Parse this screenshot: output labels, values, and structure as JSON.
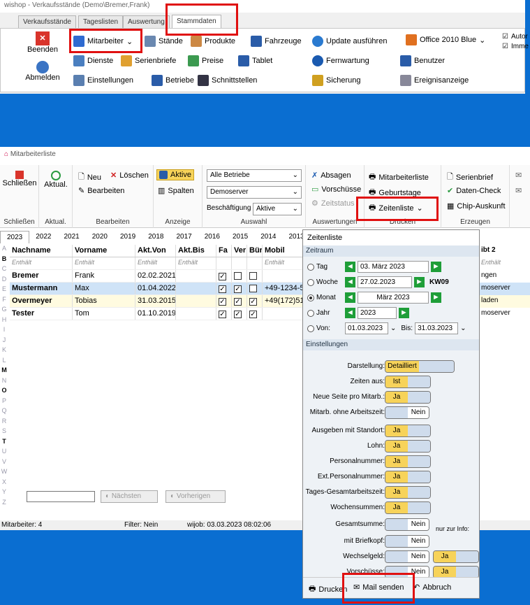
{
  "app": {
    "title": "wishop - Verkaufsstände (Demo\\Bremer,Frank)",
    "tabs": [
      "Verkaufsstände",
      "Tageslisten",
      "Auswertung",
      "Stammdaten"
    ]
  },
  "ribbon1": {
    "beenden": "Beenden",
    "abmelden": "Abmelden",
    "mitarbeiter": "Mitarbeiter",
    "staende": "Stände",
    "produkte": "Produkte",
    "fahrzeuge": "Fahrzeuge",
    "dienste": "Dienste",
    "serienbriefe": "Serienbriefe",
    "preise": "Preise",
    "tablet": "Tablet",
    "einstellungen": "Einstellungen",
    "betriebe": "Betriebe",
    "schnittstellen": "Schnittstellen",
    "update": "Update ausführen",
    "fernwartung": "Fernwartung",
    "sicherung": "Sicherung",
    "office": "Office 2010 Blue",
    "benutzer": "Benutzer",
    "ereignis": "Ereignisanzeige",
    "autor": "Autor",
    "imme": "Imme"
  },
  "win2": {
    "title": "Mitarbeiterliste"
  },
  "ribbon2": {
    "schliessen": "Schließen",
    "aktual": "Aktual.",
    "neu": "Neu",
    "loeschen": "Löschen",
    "bearbeiten": "Bearbeiten",
    "aktive": "Aktive",
    "spalten": "Spalten",
    "alle_betriebe": "Alle Betriebe",
    "demoserver": "Demoserver",
    "beschaeftigung": "Beschäftigung",
    "aktive_sel": "Aktive",
    "absagen": "Absagen",
    "vorschuesse": "Vorschüsse",
    "zeitstatus": "Zeitstatus",
    "mitarbeiterliste": "Mitarbeiterliste",
    "geburtstage": "Geburtstage",
    "zeitenliste": "Zeitenliste",
    "serienbrief": "Serienbrief",
    "datencheck": "Daten-Check",
    "chip": "Chip-Auskunft",
    "g_schliessen": "Schließen",
    "g_aktual": "Aktual.",
    "g_bearbeiten": "Bearbeiten",
    "g_anzeige": "Anzeige",
    "g_auswahl": "Auswahl",
    "g_auswertungen": "Auswertungen",
    "g_drucken": "Drucken",
    "g_erzeugen": "Erzeugen"
  },
  "years": [
    "2023",
    "2022",
    "2021",
    "2020",
    "2019",
    "2018",
    "2017",
    "2016",
    "2015",
    "2014",
    "2013"
  ],
  "letters": [
    "A",
    "B",
    "C",
    "D",
    "E",
    "F",
    "G",
    "H",
    "I",
    "J",
    "K",
    "L",
    "M",
    "N",
    "O",
    "P",
    "Q",
    "R",
    "S",
    "T",
    "U",
    "V",
    "W",
    "X",
    "Y",
    "Z"
  ],
  "table": {
    "headers": [
      "Nachname",
      "Vorname",
      "Akt.Von",
      "Akt.Bis",
      "Fa",
      "Ver",
      "Bür",
      "Mobil"
    ],
    "filter": "Enthält",
    "rows": [
      [
        "Bremer",
        "Frank",
        "02.02.2021",
        "",
        "✓",
        "",
        "",
        " "
      ],
      [
        "Mustermann",
        "Max",
        "01.04.2022",
        "",
        "✓",
        "✓",
        "",
        "+49-1234-5"
      ],
      [
        "Overmeyer",
        "Tobias",
        "31.03.2015",
        "",
        "✓",
        "✓",
        "✓",
        "+49(172)51"
      ],
      [
        "Tester",
        "Tom",
        "01.10.2019",
        "",
        "✓",
        "✓",
        "✓",
        ""
      ]
    ],
    "right_header": "ibt 2",
    "right_rows": [
      "ngen",
      "moserver",
      "laden",
      "moserver"
    ]
  },
  "search": {
    "naechsten": "Nächsten",
    "vorherigen": "Vorherigen"
  },
  "status": {
    "count": "Mitarbeiter: 4",
    "filter": "Filter: Nein",
    "job": "wijob: 03.03.2023 08:02:06"
  },
  "panel": {
    "title": "Zeitenliste",
    "zeitraum": "Zeitraum",
    "tag": "Tag",
    "woche": "Woche",
    "monat": "Monat",
    "jahr": "Jahr",
    "von": "Von:",
    "bis": "Bis:",
    "tag_val": "03.  März    2023",
    "woche_val": "27.02.2023",
    "kw": "KW09",
    "monat_val": "März    2023",
    "jahr_val": "2023",
    "von_val": "01.03.2023",
    "bis_val": "31.03.2023",
    "einstellungen": "Einstellungen",
    "settings": [
      [
        "Darstellung:",
        "Detailliert",
        ""
      ],
      [
        "Zeiten aus:",
        "Ist",
        ""
      ],
      [
        "Neue Seite pro Mitarb.:",
        "Ja",
        ""
      ],
      [
        "Mitarb. ohne Arbeitszeit:",
        "",
        "Nein"
      ],
      [
        "Ausgeben mit Standort:",
        "Ja",
        ""
      ],
      [
        "Lohn:",
        "Ja",
        ""
      ],
      [
        "Personalnummer:",
        "Ja",
        ""
      ],
      [
        "Ext.Personalnummer:",
        "Ja",
        ""
      ],
      [
        "Tages-Gesamtarbeitszeit:",
        "Ja",
        ""
      ],
      [
        "Wochensummen:",
        "Ja",
        ""
      ],
      [
        "Gesamtsumme:",
        "",
        "Nein"
      ],
      [
        "mit Briefkopf:",
        "",
        "Nein"
      ],
      [
        "Wechselgeld:",
        "",
        "Nein"
      ],
      [
        "Vorschüsse:",
        "",
        "Nein"
      ]
    ],
    "nurinfo": "nur zur Info:",
    "ja": "Ja",
    "drucken": "Drucken",
    "mail": "Mail senden",
    "abbruch": "Abbruch"
  }
}
